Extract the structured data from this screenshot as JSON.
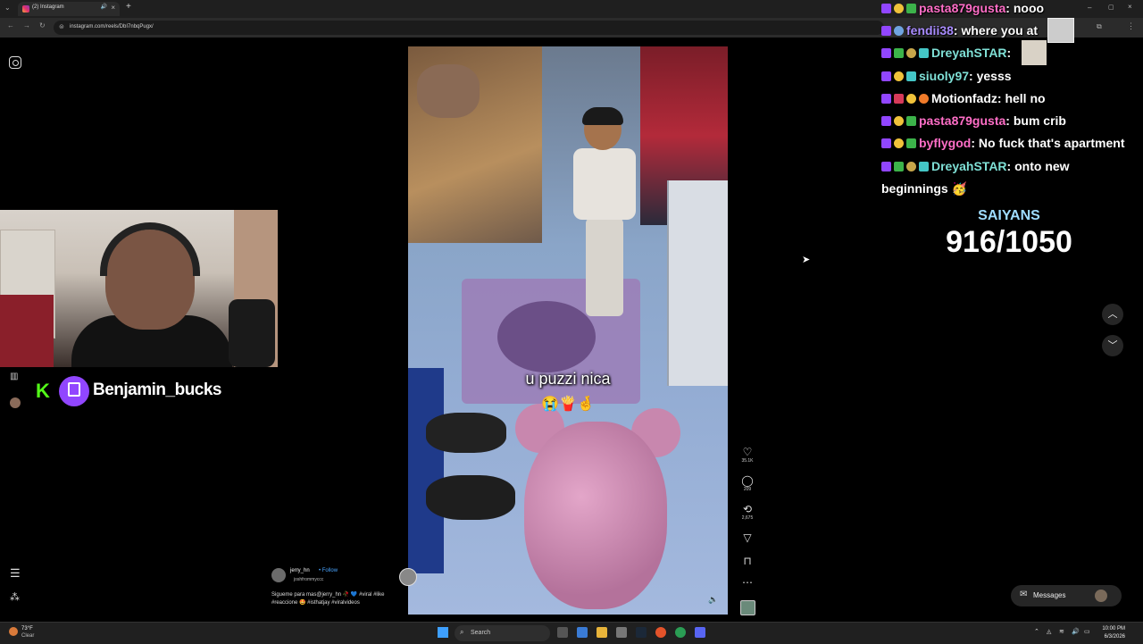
{
  "browser": {
    "tab_title": "(2) Instagram",
    "url": "instagram.com/reels/DbI7nbqPugx/"
  },
  "streamer": {
    "name": "Benjamin_bucks"
  },
  "reel": {
    "caption": "u puzzi nica",
    "caption_emojis": "😭🍟🤞",
    "username": "jerry_hn",
    "follow_label": "• Follow",
    "audio": "joshfrommyccc",
    "description": "Sigueme para mas@jerry_hn 🥀 💙 #viral #like #reaccione 🤩 #isthatjay #viralvideos",
    "likes": "35.1K",
    "comments": "209",
    "reposts": "2,675"
  },
  "chat": [
    {
      "user": "pasta879gusta",
      "color": "#ff6ec7",
      "message": "nooo"
    },
    {
      "user": "fendii38",
      "color": "#a98cff",
      "message": "where you at"
    },
    {
      "user": "DreyahSTAR",
      "color": "#7fe0d6",
      "message": ""
    },
    {
      "user": "siuoly97",
      "color": "#7fe0d6",
      "message": "yesss"
    },
    {
      "user": "Motionfadz",
      "color": "#ffffff",
      "message": "hell no"
    },
    {
      "user": "pasta879gusta",
      "color": "#ff6ec7",
      "message": "bum crib"
    },
    {
      "user": "byflygod",
      "color": "#ff6ec7",
      "message": "No fuck that's apartment"
    },
    {
      "user": "DreyahSTAR",
      "color": "#7fe0d6",
      "message": "onto new"
    },
    {
      "user": "",
      "color": "#ffffff",
      "message": "beginnings 🥳"
    }
  ],
  "goal": {
    "label": "SAIYANS",
    "count": "916/1050"
  },
  "messages_label": "Messages",
  "taskbar": {
    "weather_temp": "73°F",
    "weather_cond": "Clear",
    "search_label": "Search",
    "time": "10:00 PM",
    "date": "6/3/2026"
  },
  "colors": {
    "kick_green": "#53fc18",
    "twitch_purple": "#9146ff",
    "saiyans_blue": "#9fdcff"
  }
}
